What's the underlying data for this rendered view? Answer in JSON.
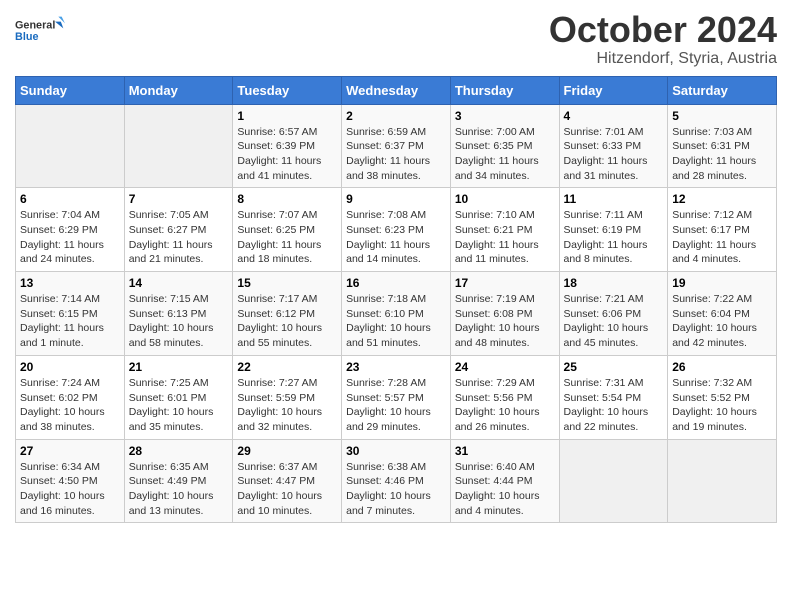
{
  "header": {
    "logo_general": "General",
    "logo_blue": "Blue",
    "month_title": "October 2024",
    "location": "Hitzendorf, Styria, Austria"
  },
  "weekdays": [
    "Sunday",
    "Monday",
    "Tuesday",
    "Wednesday",
    "Thursday",
    "Friday",
    "Saturday"
  ],
  "weeks": [
    [
      {
        "num": "",
        "empty": true
      },
      {
        "num": "",
        "empty": true
      },
      {
        "num": "1",
        "sunrise": "6:57 AM",
        "sunset": "6:39 PM",
        "daylight": "11 hours and 41 minutes."
      },
      {
        "num": "2",
        "sunrise": "6:59 AM",
        "sunset": "6:37 PM",
        "daylight": "11 hours and 38 minutes."
      },
      {
        "num": "3",
        "sunrise": "7:00 AM",
        "sunset": "6:35 PM",
        "daylight": "11 hours and 34 minutes."
      },
      {
        "num": "4",
        "sunrise": "7:01 AM",
        "sunset": "6:33 PM",
        "daylight": "11 hours and 31 minutes."
      },
      {
        "num": "5",
        "sunrise": "7:03 AM",
        "sunset": "6:31 PM",
        "daylight": "11 hours and 28 minutes."
      }
    ],
    [
      {
        "num": "6",
        "sunrise": "7:04 AM",
        "sunset": "6:29 PM",
        "daylight": "11 hours and 24 minutes."
      },
      {
        "num": "7",
        "sunrise": "7:05 AM",
        "sunset": "6:27 PM",
        "daylight": "11 hours and 21 minutes."
      },
      {
        "num": "8",
        "sunrise": "7:07 AM",
        "sunset": "6:25 PM",
        "daylight": "11 hours and 18 minutes."
      },
      {
        "num": "9",
        "sunrise": "7:08 AM",
        "sunset": "6:23 PM",
        "daylight": "11 hours and 14 minutes."
      },
      {
        "num": "10",
        "sunrise": "7:10 AM",
        "sunset": "6:21 PM",
        "daylight": "11 hours and 11 minutes."
      },
      {
        "num": "11",
        "sunrise": "7:11 AM",
        "sunset": "6:19 PM",
        "daylight": "11 hours and 8 minutes."
      },
      {
        "num": "12",
        "sunrise": "7:12 AM",
        "sunset": "6:17 PM",
        "daylight": "11 hours and 4 minutes."
      }
    ],
    [
      {
        "num": "13",
        "sunrise": "7:14 AM",
        "sunset": "6:15 PM",
        "daylight": "11 hours and 1 minute."
      },
      {
        "num": "14",
        "sunrise": "7:15 AM",
        "sunset": "6:13 PM",
        "daylight": "10 hours and 58 minutes."
      },
      {
        "num": "15",
        "sunrise": "7:17 AM",
        "sunset": "6:12 PM",
        "daylight": "10 hours and 55 minutes."
      },
      {
        "num": "16",
        "sunrise": "7:18 AM",
        "sunset": "6:10 PM",
        "daylight": "10 hours and 51 minutes."
      },
      {
        "num": "17",
        "sunrise": "7:19 AM",
        "sunset": "6:08 PM",
        "daylight": "10 hours and 48 minutes."
      },
      {
        "num": "18",
        "sunrise": "7:21 AM",
        "sunset": "6:06 PM",
        "daylight": "10 hours and 45 minutes."
      },
      {
        "num": "19",
        "sunrise": "7:22 AM",
        "sunset": "6:04 PM",
        "daylight": "10 hours and 42 minutes."
      }
    ],
    [
      {
        "num": "20",
        "sunrise": "7:24 AM",
        "sunset": "6:02 PM",
        "daylight": "10 hours and 38 minutes."
      },
      {
        "num": "21",
        "sunrise": "7:25 AM",
        "sunset": "6:01 PM",
        "daylight": "10 hours and 35 minutes."
      },
      {
        "num": "22",
        "sunrise": "7:27 AM",
        "sunset": "5:59 PM",
        "daylight": "10 hours and 32 minutes."
      },
      {
        "num": "23",
        "sunrise": "7:28 AM",
        "sunset": "5:57 PM",
        "daylight": "10 hours and 29 minutes."
      },
      {
        "num": "24",
        "sunrise": "7:29 AM",
        "sunset": "5:56 PM",
        "daylight": "10 hours and 26 minutes."
      },
      {
        "num": "25",
        "sunrise": "7:31 AM",
        "sunset": "5:54 PM",
        "daylight": "10 hours and 22 minutes."
      },
      {
        "num": "26",
        "sunrise": "7:32 AM",
        "sunset": "5:52 PM",
        "daylight": "10 hours and 19 minutes."
      }
    ],
    [
      {
        "num": "27",
        "sunrise": "6:34 AM",
        "sunset": "4:50 PM",
        "daylight": "10 hours and 16 minutes."
      },
      {
        "num": "28",
        "sunrise": "6:35 AM",
        "sunset": "4:49 PM",
        "daylight": "10 hours and 13 minutes."
      },
      {
        "num": "29",
        "sunrise": "6:37 AM",
        "sunset": "4:47 PM",
        "daylight": "10 hours and 10 minutes."
      },
      {
        "num": "30",
        "sunrise": "6:38 AM",
        "sunset": "4:46 PM",
        "daylight": "10 hours and 7 minutes."
      },
      {
        "num": "31",
        "sunrise": "6:40 AM",
        "sunset": "4:44 PM",
        "daylight": "10 hours and 4 minutes."
      },
      {
        "num": "",
        "empty": true
      },
      {
        "num": "",
        "empty": true
      }
    ]
  ]
}
